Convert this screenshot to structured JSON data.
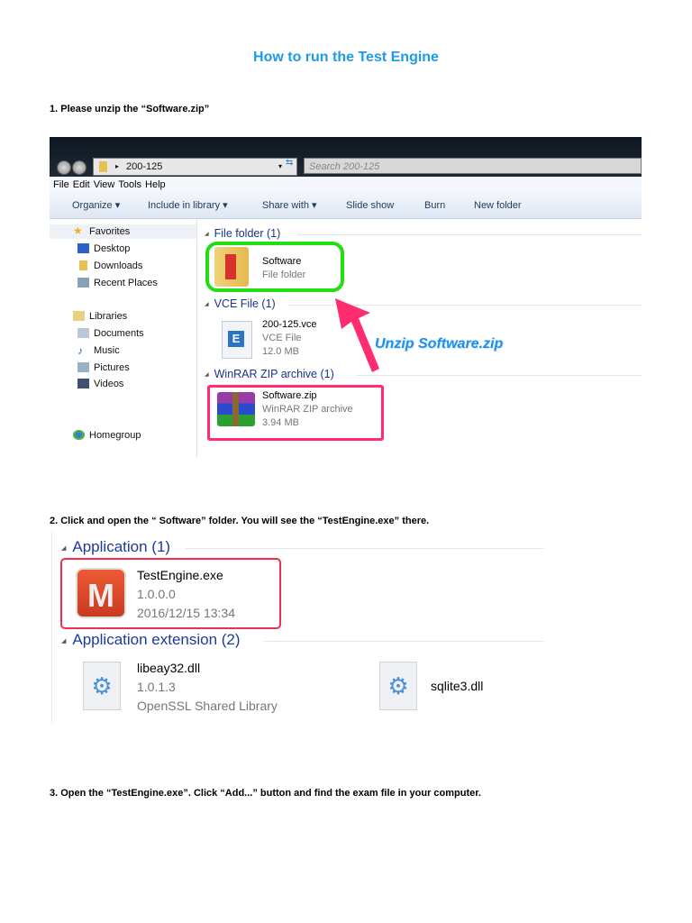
{
  "title": "How to run the Test Engine",
  "steps": [
    "1. Please unzip the “Software.zip”",
    "2. Click and open the “ Software” folder. You will see the “TestEngine.exe” there.",
    "3. Open the “TestEngine.exe”. Click “Add...” button and find the exam file in your computer."
  ],
  "explorer": {
    "address": "200-125",
    "search_placeholder": "Search 200-125",
    "menu": [
      "File",
      "Edit",
      "View",
      "Tools",
      "Help"
    ],
    "toolbar": [
      "Organize ▾",
      "Include in library ▾",
      "Share with ▾",
      "Slide show",
      "Burn",
      "New folder"
    ],
    "sidebar": [
      "Favorites",
      "Desktop",
      "Downloads",
      "Recent Places",
      "Libraries",
      "Documents",
      "Music",
      "Pictures",
      "Videos",
      "Homegroup"
    ],
    "groups": [
      {
        "label": "File folder (1)",
        "item": {
          "name": "Software",
          "lines": [
            "File folder"
          ]
        }
      },
      {
        "label": "VCE File (1)",
        "item": {
          "name": "200-125.vce",
          "lines": [
            "VCE File",
            "12.0 MB"
          ]
        }
      },
      {
        "label": "WinRAR ZIP archive (1)",
        "item": {
          "name": "Software.zip",
          "lines": [
            "WinRAR ZIP archive",
            "3.94 MB"
          ]
        }
      }
    ],
    "annotation": "Unzip Software.zip",
    "colors": {
      "green": "#22dd11",
      "pink": "#ff2d6f",
      "annotation": "#1e8fe8"
    }
  },
  "folder": {
    "groups": [
      "Application (1)",
      "Application extension (2)"
    ],
    "app": {
      "name": "TestEngine.exe",
      "version": "1.0.0.0",
      "date": "2016/12/15 13:34",
      "icon_letter": "M"
    },
    "dlls": [
      {
        "name": "libeay32.dll",
        "version": "1.0.1.3",
        "desc": "OpenSSL Shared Library"
      },
      {
        "name": "sqlite3.dll"
      }
    ]
  }
}
